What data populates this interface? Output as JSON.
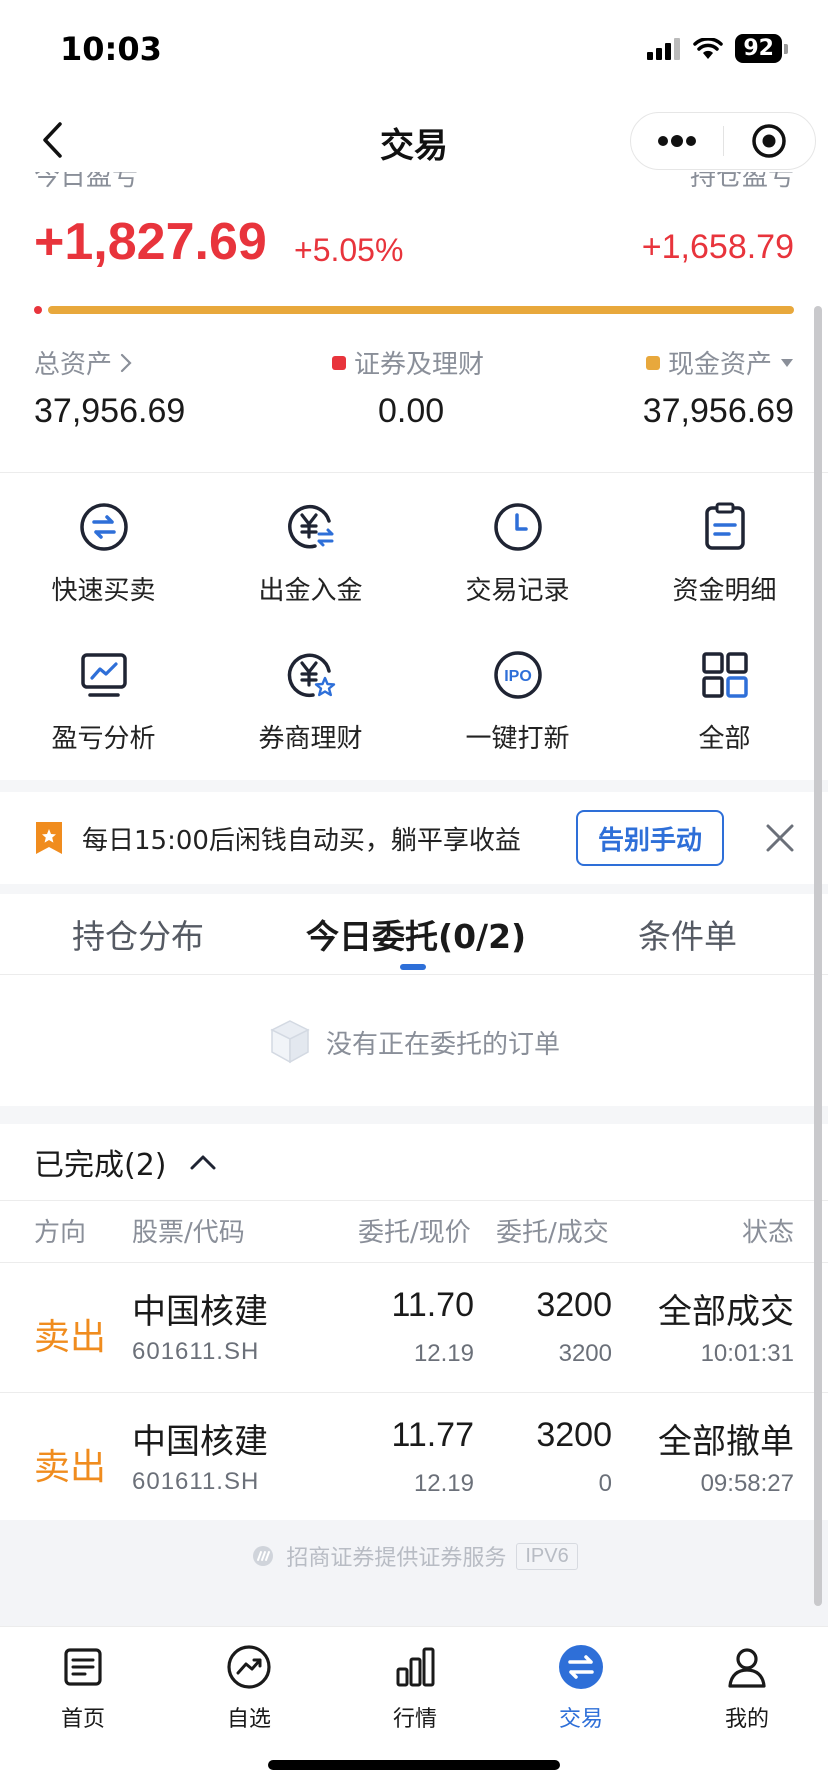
{
  "status_bar": {
    "time": "10:03",
    "battery": "92"
  },
  "nav": {
    "title": "交易"
  },
  "summary": {
    "today_pnl_label": "今日盈亏",
    "hold_pnl_label": "持仓盈亏",
    "today_pnl": "+1,827.69",
    "today_pnl_pct": "+5.05%",
    "hold_pnl": "+1,658.79",
    "securities_ratio": 0.0,
    "colors": {
      "up": "#e8343c",
      "securities": "#e8343c",
      "cash": "#e8a83c"
    }
  },
  "assets": {
    "total_label": "总资产",
    "securities_label": "证券及理财",
    "cash_label": "现金资产",
    "total_value": "37,956.69",
    "securities_value": "0.00",
    "cash_value": "37,956.69"
  },
  "quick_actions": [
    {
      "label": "快速买卖",
      "icon": "swap-circle-icon"
    },
    {
      "label": "出金入金",
      "icon": "yuan-transfer-icon"
    },
    {
      "label": "交易记录",
      "icon": "clock-icon"
    },
    {
      "label": "资金明细",
      "icon": "clipboard-icon"
    },
    {
      "label": "盈亏分析",
      "icon": "chart-monitor-icon"
    },
    {
      "label": "券商理财",
      "icon": "yuan-star-icon"
    },
    {
      "label": "一键打新",
      "icon": "ipo-icon"
    },
    {
      "label": "全部",
      "icon": "grid-icon"
    }
  ],
  "promo": {
    "text": "每日15:00后闲钱自动买，躺平享收益",
    "button": "告别手动"
  },
  "tabs": [
    "持仓分布",
    "今日委托(0/2)",
    "条件单"
  ],
  "active_tab": 1,
  "empty_state": "没有正在委托的订单",
  "completed": {
    "title": "已完成(2)",
    "headers": [
      "方向",
      "股票/代码",
      "委托/现价",
      "委托/成交",
      "状态"
    ],
    "rows": [
      {
        "direction": "卖出",
        "name": "中国核建",
        "code": "601611.SH",
        "order_price": "11.70",
        "current_price": "12.19",
        "order_qty": "3200",
        "filled_qty": "3200",
        "status": "全部成交",
        "time": "10:01:31"
      },
      {
        "direction": "卖出",
        "name": "中国核建",
        "code": "601611.SH",
        "order_price": "11.77",
        "current_price": "12.19",
        "order_qty": "3200",
        "filled_qty": "0",
        "status": "全部撤单",
        "time": "09:58:27"
      }
    ]
  },
  "footer": {
    "text": "招商证券提供证券服务",
    "badge": "IPV6"
  },
  "tabbar": [
    {
      "label": "首页",
      "icon": "home-doc-icon"
    },
    {
      "label": "自选",
      "icon": "trend-icon"
    },
    {
      "label": "行情",
      "icon": "bar-chart-icon"
    },
    {
      "label": "交易",
      "icon": "trade-swap-icon"
    },
    {
      "label": "我的",
      "icon": "person-icon"
    }
  ],
  "active_tabbar": 3
}
